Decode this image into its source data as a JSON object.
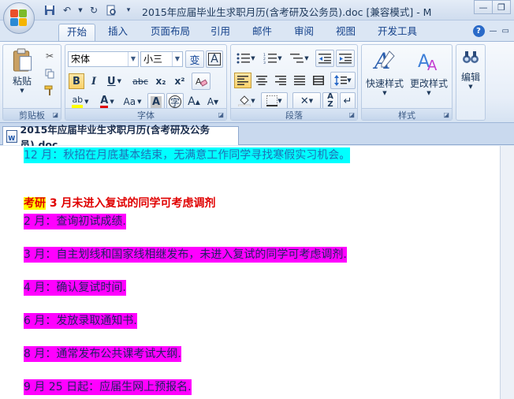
{
  "window": {
    "title": "2015年应届毕业生求职月历(含考研及公务员).doc [兼容模式] - M"
  },
  "quick_access": [
    "save-icon",
    "undo-icon",
    "redo-icon",
    "print-preview-icon",
    "customize-icon"
  ],
  "tabs": [
    {
      "label": "开始",
      "active": true
    },
    {
      "label": "插入"
    },
    {
      "label": "页面布局"
    },
    {
      "label": "引用"
    },
    {
      "label": "邮件"
    },
    {
      "label": "审阅"
    },
    {
      "label": "视图"
    },
    {
      "label": "开发工具"
    }
  ],
  "ribbon": {
    "clipboard": {
      "group_label": "剪贴板",
      "paste_label": "粘贴"
    },
    "font": {
      "group_label": "字体",
      "font_name": "宋体",
      "font_size": "小三",
      "phonetic": "变",
      "char_border": "A",
      "bold": "B",
      "italic": "I",
      "underline": "U",
      "strike": "abc",
      "sub": "x₂",
      "sup": "x²",
      "grow": "A",
      "shrink": "A",
      "case": "Aa"
    },
    "paragraph": {
      "group_label": "段落"
    },
    "styles": {
      "group_label": "样式",
      "quick_styles": "快速样式",
      "change_styles": "更改样式"
    },
    "editing": {
      "label": "编辑"
    }
  },
  "document_tab": {
    "label": "2015年应届毕业生求职月历(含考研及公务员).doc"
  },
  "document": {
    "line1": "12 月：秋招在月底基本结束，无满意工作同学寻找寒假实习机会。",
    "heading_prefix": "考研",
    "heading_text": " 3 月未进入复试的同学可考虑调剂",
    "items": [
      "2 月：查询初试成绩.",
      "3 月：自主划线和国家线相继发布，未进入复试的同学可考虑调剂.",
      "4 月：确认复试时间.",
      "6 月：发放录取通知书.",
      "8 月：通常发布公共课考试大纲.",
      "9 月 25 日起：应届生网上预报名."
    ]
  },
  "colors": {
    "cyan_highlight": "#00ffff",
    "magenta_highlight": "#ff00ff",
    "yellow_highlight": "#ffff00",
    "heading_red": "#e00000"
  }
}
